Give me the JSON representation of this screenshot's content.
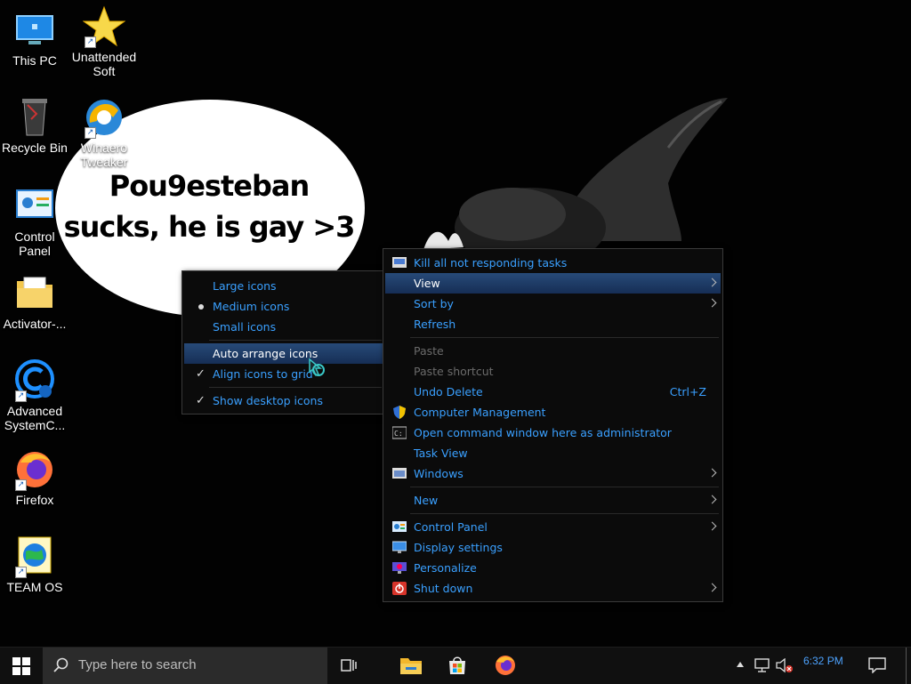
{
  "wallpaper": {
    "bubble_line1": "Pou9esteban",
    "bubble_line2": "sucks, he is gay >3"
  },
  "desktop_icons": [
    {
      "label1": "This PC",
      "label2": "",
      "icon": "this-pc-icon"
    },
    {
      "label1": "Unattended",
      "label2": "Soft",
      "icon": "star-icon"
    },
    {
      "label1": "Recycle Bin",
      "label2": "",
      "icon": "recycle-bin-icon"
    },
    {
      "label1": "Winaero",
      "label2": "Tweaker",
      "icon": "winaero-tweaker-icon"
    },
    {
      "label1": "Control",
      "label2": "Panel",
      "icon": "control-panel-icon"
    },
    {
      "label1": "Activator-...",
      "label2": "",
      "icon": "folder-icon"
    },
    {
      "label1": "Advanced",
      "label2": "SystemC...",
      "icon": "advanced-systemcare-icon"
    },
    {
      "label1": "Firefox",
      "label2": "",
      "icon": "firefox-icon"
    },
    {
      "label1": "TEAM OS",
      "label2": "",
      "icon": "team-os-icon"
    }
  ],
  "main_menu": {
    "items": [
      {
        "label": "Kill all not responding tasks",
        "icon": "kill-tasks-icon"
      },
      {
        "label": "View"
      },
      {
        "label": "Sort by"
      },
      {
        "label": "Refresh"
      },
      {
        "label": "Paste"
      },
      {
        "label": "Paste shortcut"
      },
      {
        "label": "Undo Delete",
        "shortcut": "Ctrl+Z"
      },
      {
        "label": "Computer Management",
        "icon": "shield-icon"
      },
      {
        "label": "Open command window here as administrator",
        "icon": "cmd-icon"
      },
      {
        "label": "Task View"
      },
      {
        "label": "Windows",
        "icon": "window-icon"
      },
      {
        "label": "New"
      },
      {
        "label": "Control Panel",
        "icon": "control-panel-icon"
      },
      {
        "label": "Display settings",
        "icon": "display-icon"
      },
      {
        "label": "Personalize",
        "icon": "personalize-icon"
      },
      {
        "label": "Shut down",
        "icon": "power-icon"
      }
    ]
  },
  "view_submenu": {
    "items": [
      {
        "label": "Large icons"
      },
      {
        "label": "Medium icons"
      },
      {
        "label": "Small icons"
      },
      {
        "label": "Auto arrange icons"
      },
      {
        "label": "Align icons to grid"
      },
      {
        "label": "Show desktop icons"
      }
    ]
  },
  "taskbar": {
    "search_placeholder": "Type here to search",
    "time": "6:32 PM"
  },
  "colors": {
    "menu_text": "#3aa0ff",
    "menu_disabled": "#6b6b6b",
    "menu_highlight": "#1d3b66",
    "taskbar": "#101010"
  }
}
